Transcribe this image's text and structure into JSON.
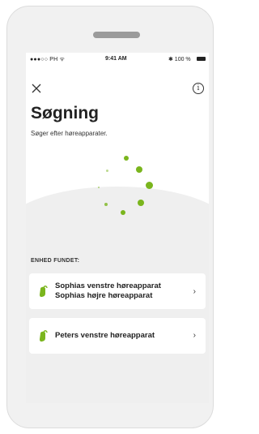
{
  "status_bar": {
    "carrier": "●●●○○ PH ᯤ",
    "time": "9:41 AM",
    "battery": "✱ 100 %"
  },
  "header": {
    "close_icon": "close-icon",
    "info_icon": "info-icon",
    "info_glyph": "i"
  },
  "main": {
    "title": "Søgning",
    "subtitle": "Søger efter høreapparater."
  },
  "found": {
    "label": "ENHED FUNDET:",
    "devices": [
      {
        "lines": [
          "Sophias venstre høreapparat",
          "Sophias højre høreapparat"
        ],
        "icon": "hearing-aid-icon"
      },
      {
        "lines": [
          "Peters venstre høreapparat"
        ],
        "icon": "hearing-aid-icon"
      }
    ],
    "chevron": "›"
  },
  "colors": {
    "accent": "#7ab51d",
    "background": "#efefef",
    "card": "#ffffff"
  }
}
